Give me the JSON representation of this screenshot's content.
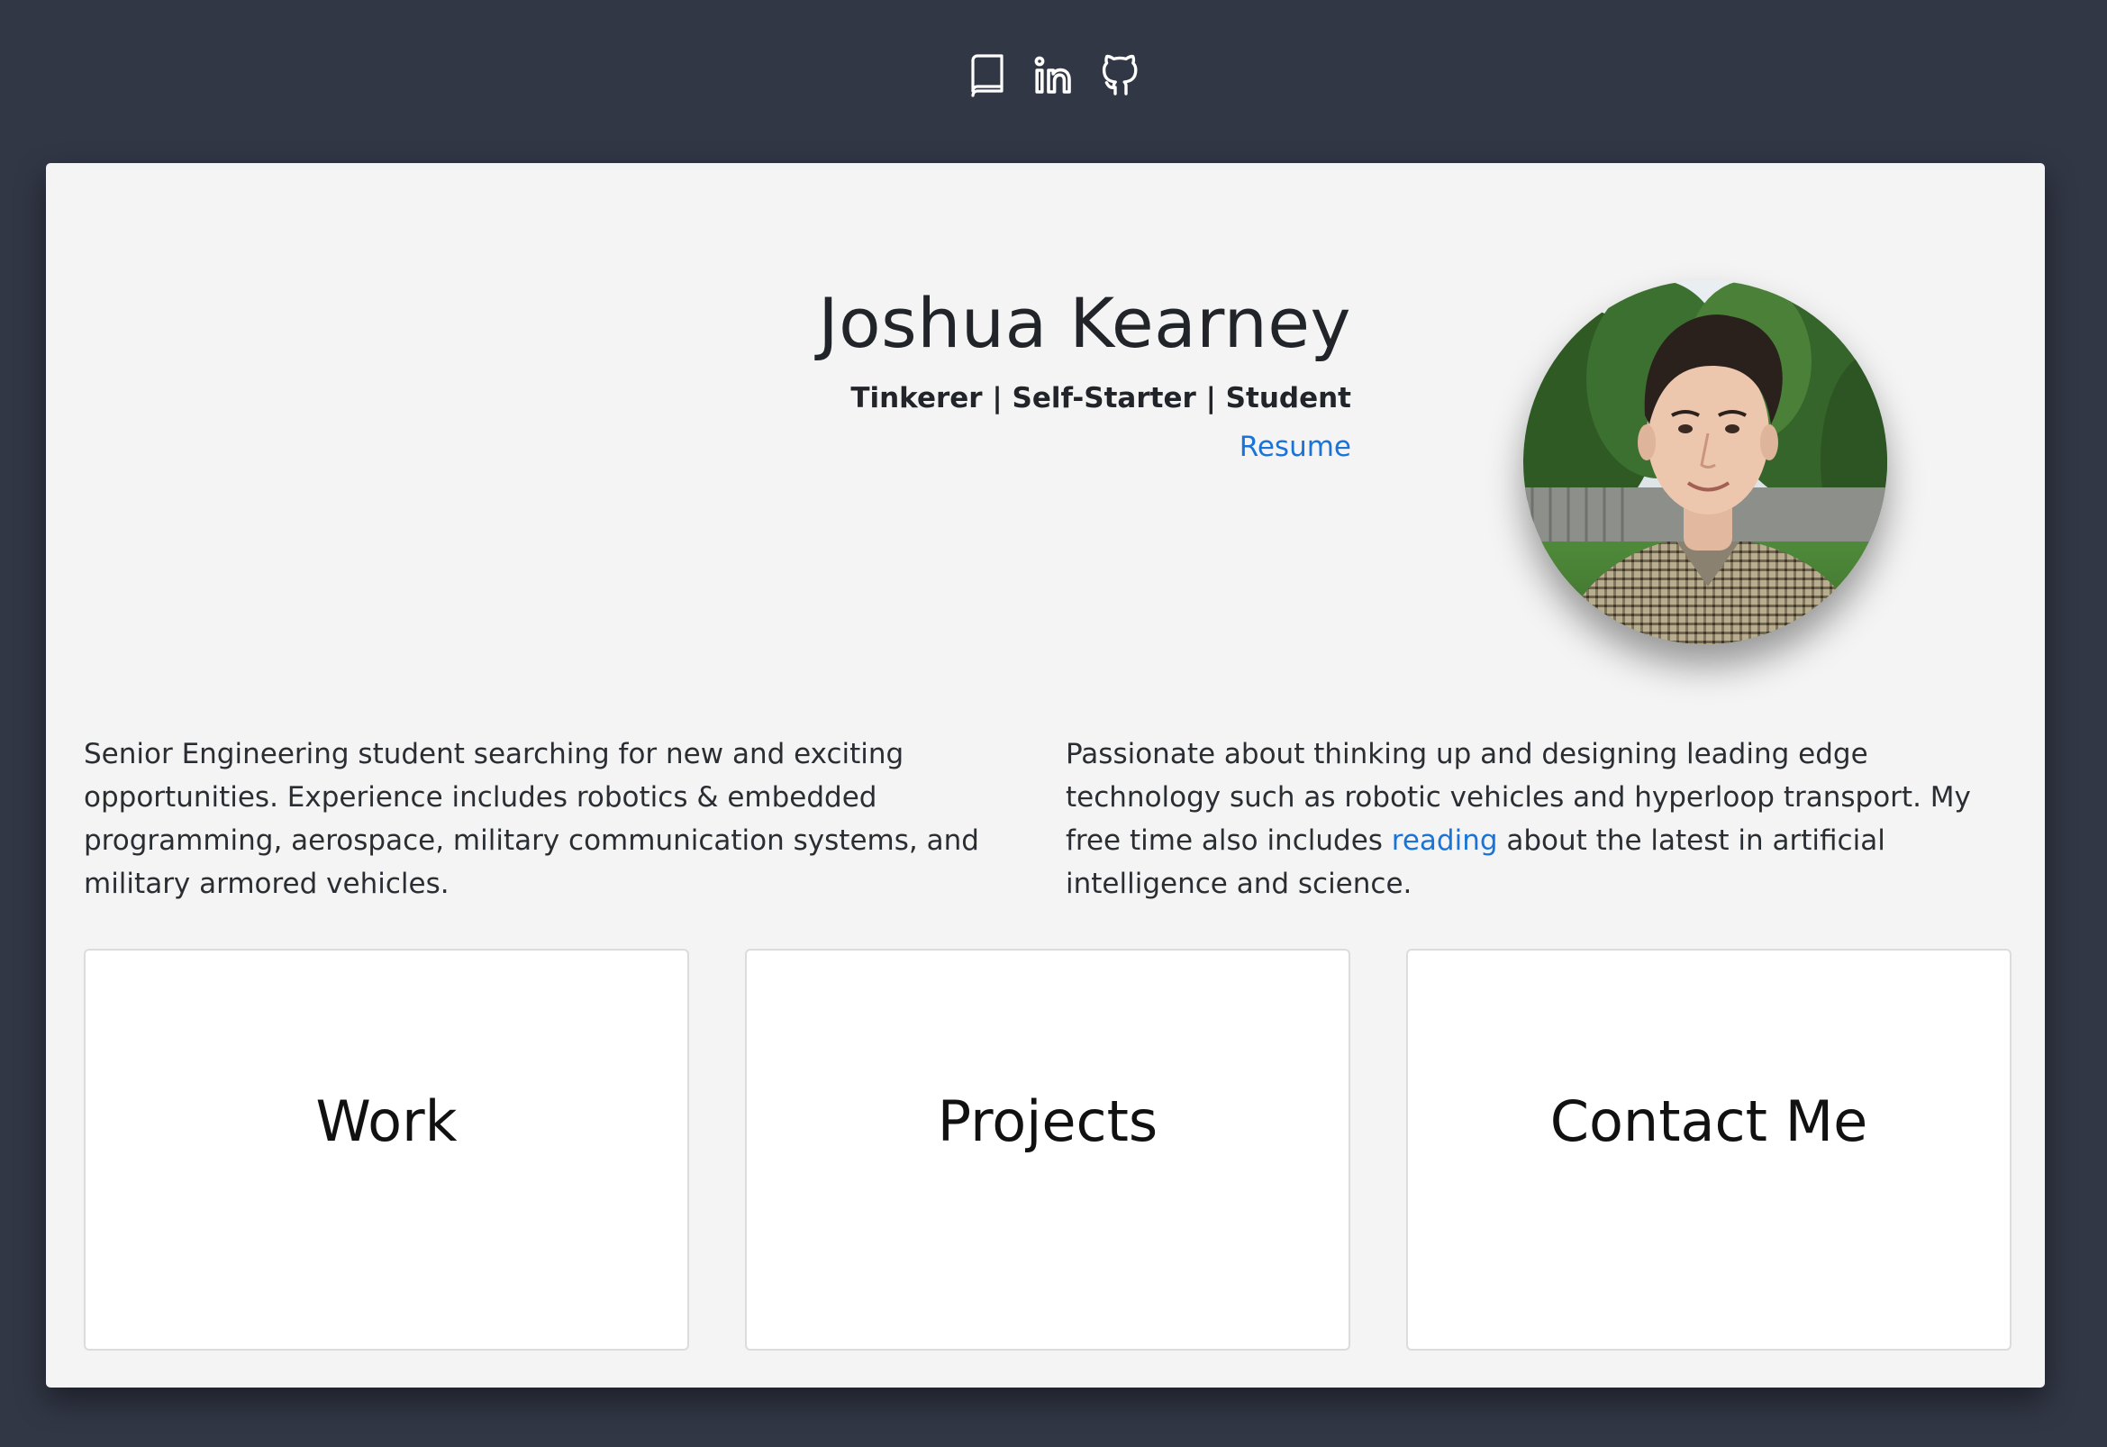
{
  "nav_icons": [
    {
      "name": "book-icon"
    },
    {
      "name": "linkedin-icon"
    },
    {
      "name": "github-icon"
    }
  ],
  "profile": {
    "name": "Joshua Kearney",
    "tagline": "Tinkerer | Self-Starter | Student",
    "resume_label": "Resume"
  },
  "about": {
    "left": "Senior Engineering student searching for new and exciting opportunities. Experience includes robotics & embedded programming, aerospace, military communication systems, and military armored vehicles.",
    "right_before": "Passionate about thinking up and designing leading edge technology such as robotic vehicles and hyperloop transport. My free time also includes ",
    "right_link": "reading",
    "right_after": " about the latest in artificial intelligence and science."
  },
  "tiles": [
    {
      "label": "Work"
    },
    {
      "label": "Projects"
    },
    {
      "label": "Contact Me"
    }
  ],
  "colors": {
    "background": "#323746",
    "card": "#f4f4f4",
    "link": "#1a74d8",
    "text": "#212529"
  }
}
